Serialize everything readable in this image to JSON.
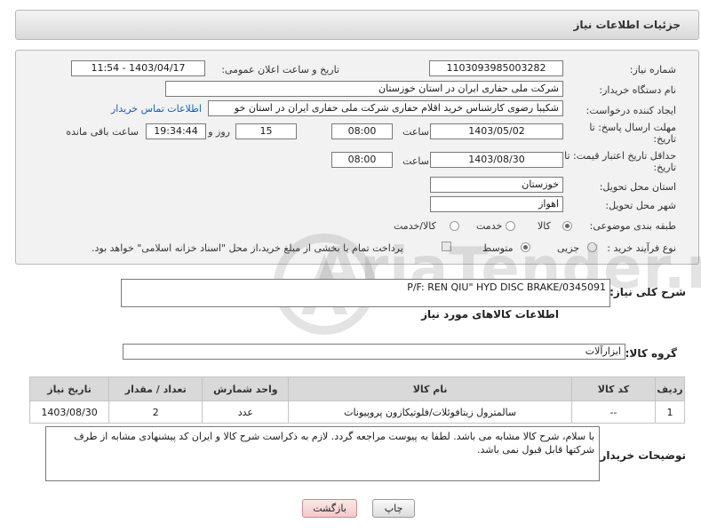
{
  "page": {
    "header_title": "جزئیات اطلاعات نیاز"
  },
  "form": {
    "need_number_label": "شماره نیاز:",
    "need_number": "1103093985003282",
    "announce_label": "تاریخ و ساعت اعلان عمومی:",
    "announce_value": "1403/04/17 - 11:54",
    "buyer_org_label": "نام دستگاه خریدار:",
    "buyer_org": "شرکت ملی حفاری ایران در استان خوزستان",
    "creator_label": "ایجاد کننده درخواست:",
    "creator": "شکیبا رضوی کارشناس خرید اقلام حفاری شرکت ملی حفاری ایران در استان خو",
    "contact_link": "اطلاعات تماس خریدار",
    "deadline_label_1": "مهلت ارسال پاسخ: تا",
    "deadline_label_2": "تاریخ:",
    "deadline_date": "1403/05/02",
    "time_label": "ساعت",
    "deadline_time": "08:00",
    "days_value": "15",
    "days_label": "روز و",
    "remaining_time": "19:34:44",
    "remaining_label": "ساعت باقی مانده",
    "validity_label_1": "حداقل تاریخ اعتبار قیمت: تا",
    "validity_label_2": "تاریخ:",
    "validity_date": "1403/08/30",
    "validity_time": "08:00",
    "province_label": "استان محل تحویل:",
    "province": "خوزستان",
    "city_label": "شهر محل تحویل:",
    "city": "اهواز",
    "category_label": "طبقه بندی موضوعی:",
    "category_options": [
      "کالا",
      "خدمت",
      "کالا/خدمت"
    ],
    "category_selected": "کالا",
    "process_label": "نوع فرآیند خرید :",
    "process_options": [
      "جزیی",
      "متوسط"
    ],
    "process_selected": "متوسط",
    "payment_note": "پرداخت تمام یا بخشی از مبلغ خرید،از محل \"اسناد خزانه اسلامی\" خواهد بود."
  },
  "summary": {
    "label": "شرح کلی نیاز:",
    "value": "P/F: REN QIU\" HYD DISC BRAKE/0345091"
  },
  "goods": {
    "section_title": "اطلاعات کالاهای مورد نیاز",
    "group_label": "گروه کالا:",
    "group_value": "ابزارآلات",
    "columns": [
      "ردیف",
      "کد کالا",
      "نام کالا",
      "واحد شمارش",
      "تعداد / مقدار",
      "تاریخ نیاز"
    ],
    "rows": [
      {
        "row": "1",
        "code": "--",
        "name": "سالمترول زیتافوئلات/فلوتیکازون پروپیونات",
        "unit": "عدد",
        "qty": "2",
        "date": "1403/08/30"
      }
    ]
  },
  "notes": {
    "label": "توضیحات خریدار:",
    "text": "با سلام، شرح کالا مشابه می باشد. لطفا به پیوست مراجعه گردد. لازم به ذکراست شرح کالا و ایران کد  پیشنهادی مشابه از طرف شرکتها قابل قبول نمی باشد."
  },
  "actions": {
    "print_label": "چاپ",
    "back_label": "بازگشت"
  },
  "watermark": {
    "text": "AriaTender.neT"
  },
  "colors": {
    "link": "#1a5eb8",
    "panel_bg": "#f2f2f2",
    "table_header": "#d9d9d9",
    "back_button": "#f3c9c9"
  }
}
